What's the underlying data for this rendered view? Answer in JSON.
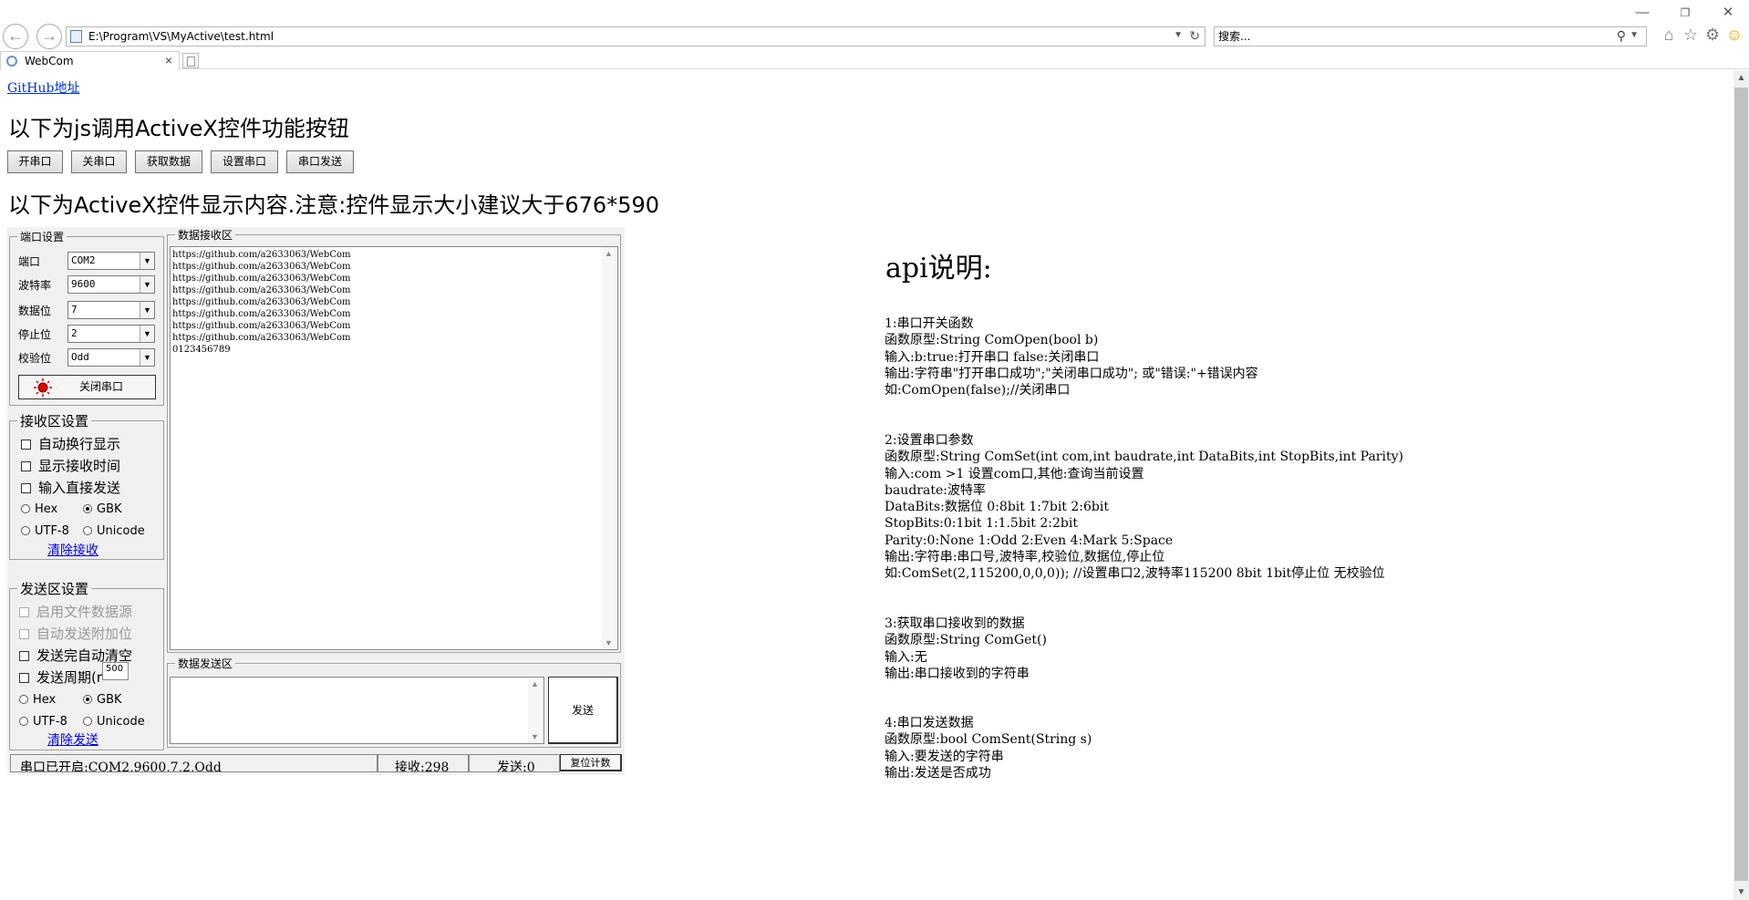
{
  "browser": {
    "address": "E:\\Program\\VS\\MyActive\\test.html",
    "search_placeholder": "搜索...",
    "tab_title": "WebCom"
  },
  "page": {
    "github_link": "GitHub地址",
    "heading_buttons": "以下为js调用ActiveX控件功能按钮",
    "buttons": [
      "开串口",
      "关串口",
      "获取数据",
      "设置串口",
      "串口发送"
    ],
    "heading_control": "以下为ActiveX控件显示内容.注意:控件显示大小建议大于676*590"
  },
  "control": {
    "port_group": {
      "title": "端口设置",
      "fields": [
        {
          "label": "端口",
          "value": "COM2"
        },
        {
          "label": "波特率",
          "value": "9600"
        },
        {
          "label": "数据位",
          "value": "7"
        },
        {
          "label": "停止位",
          "value": "2"
        },
        {
          "label": "校验位",
          "value": "Odd"
        }
      ],
      "toggle_button": "关闭串口",
      "indicator_color": "#e00000"
    },
    "rx_group": {
      "title": "接收区设置",
      "checks": [
        "自动换行显示",
        "显示接收时间",
        "输入直接发送"
      ],
      "radios_row1": [
        {
          "label": "Hex",
          "checked": false
        },
        {
          "label": "GBK",
          "checked": true
        }
      ],
      "radios_row2": [
        {
          "label": "UTF-8",
          "checked": false
        },
        {
          "label": "Unicode",
          "checked": false
        }
      ],
      "clear_link": "清除接收"
    },
    "tx_group": {
      "title": "发送区设置",
      "checks": [
        {
          "label": "启用文件数据源",
          "disabled": true
        },
        {
          "label": "自动发送附加位",
          "disabled": true
        },
        {
          "label": "发送完自动清空",
          "disabled": false
        },
        {
          "label": "发送周期(r",
          "disabled": false
        }
      ],
      "period_value": "500",
      "radios_row1": [
        {
          "label": "Hex",
          "checked": false
        },
        {
          "label": "GBK",
          "checked": true
        }
      ],
      "radios_row2": [
        {
          "label": "UTF-8",
          "checked": false
        },
        {
          "label": "Unicode",
          "checked": false
        }
      ],
      "clear_link": "清除发送"
    },
    "receive_area": {
      "title": "数据接收区",
      "lines": [
        "https://github.com/a2633063/WebCom",
        "https://github.com/a2633063/WebCom",
        "https://github.com/a2633063/WebCom",
        "https://github.com/a2633063/WebCom",
        "https://github.com/a2633063/WebCom",
        "https://github.com/a2633063/WebCom",
        "https://github.com/a2633063/WebCom",
        "https://github.com/a2633063/WebCom",
        "0123456789"
      ]
    },
    "send_area": {
      "title": "数据发送区",
      "send_button": "发送"
    },
    "status_bar": {
      "state": "串口已开启:COM2,9600,7,2,Odd",
      "rx_count": "接收:298",
      "tx_count": "发送:0",
      "reset_button": "复位计数"
    }
  },
  "api": {
    "title": "api说明:",
    "sections": [
      {
        "lines": [
          "1:串口开关函数",
          "函数原型:String ComOpen(bool b)",
          "输入:b:true:打开串口 false:关闭串口",
          "输出:字符串\"打开串口成功\";\"关闭串口成功\"; 或\"错误:\"+错误内容",
          "如:ComOpen(false);//关闭串口"
        ]
      },
      {
        "lines": [
          "2:设置串口参数",
          "函数原型:String ComSet(int com,int baudrate,int DataBits,int StopBits,int Parity)",
          "输入:com >1 设置com口,其他:查询当前设置",
          "baudrate:波特率",
          "DataBits:数据位 0:8bit 1:7bit 2:6bit",
          "StopBits:0:1bit 1:1.5bit 2:2bit",
          "Parity:0:None 1:Odd 2:Even 4:Mark 5:Space",
          "输出:字符串:串口号,波特率,校验位,数据位,停止位",
          "如:ComSet(2,115200,0,0,0)); //设置串口2,波特率115200 8bit 1bit停止位 无校验位"
        ]
      },
      {
        "lines": [
          "3:获取串口接收到的数据",
          "函数原型:String ComGet()",
          "输入:无",
          "输出:串口接收到的字符串"
        ]
      },
      {
        "lines": [
          "4:串口发送数据",
          "函数原型:bool ComSent(String s)",
          "输入:要发送的字符串",
          "输出:发送是否成功"
        ]
      }
    ]
  }
}
